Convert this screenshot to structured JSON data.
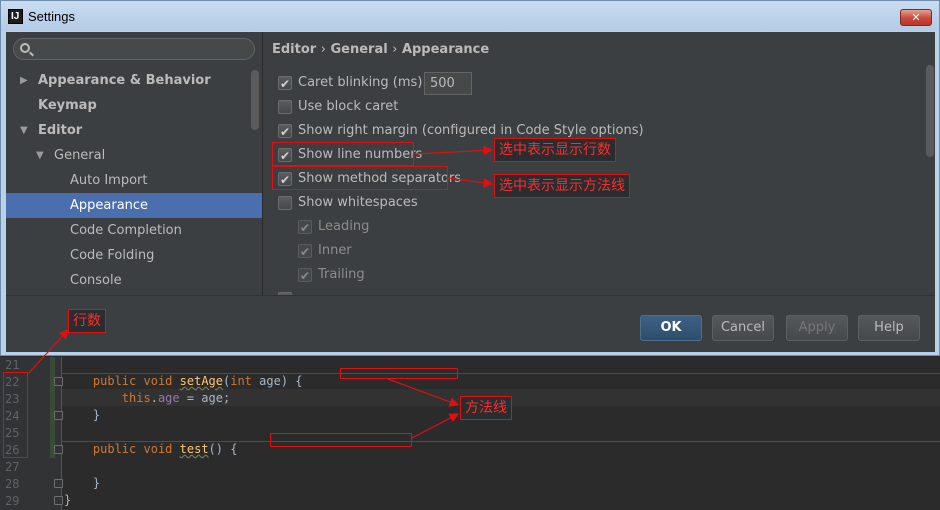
{
  "window": {
    "title": "Settings",
    "logo_letters": "IJ",
    "close_glyph": "✕"
  },
  "sidebar": {
    "search_placeholder": "",
    "items": [
      {
        "label": "Appearance & Behavior",
        "level": 0,
        "bold": true,
        "arrow": "▶",
        "selected": false
      },
      {
        "label": "Keymap",
        "level": 0,
        "bold": true,
        "arrow": "",
        "selected": false
      },
      {
        "label": "Editor",
        "level": 0,
        "bold": true,
        "arrow": "▼",
        "selected": false
      },
      {
        "label": "General",
        "level": 1,
        "bold": false,
        "arrow": "▼",
        "selected": false
      },
      {
        "label": "Auto Import",
        "level": 2,
        "bold": false,
        "arrow": "",
        "selected": false
      },
      {
        "label": "Appearance",
        "level": 2,
        "bold": false,
        "arrow": "",
        "selected": true
      },
      {
        "label": "Code Completion",
        "level": 2,
        "bold": false,
        "arrow": "",
        "selected": false
      },
      {
        "label": "Code Folding",
        "level": 2,
        "bold": false,
        "arrow": "",
        "selected": false
      },
      {
        "label": "Console",
        "level": 2,
        "bold": false,
        "arrow": "",
        "selected": false
      }
    ]
  },
  "breadcrumb": {
    "editor": "Editor",
    "general": "General",
    "appearance": "Appearance",
    "separator": "›"
  },
  "options": {
    "caret_blinking": {
      "label": "Caret blinking (ms):",
      "checked": true,
      "value": "500"
    },
    "block_caret": {
      "label": "Use block caret",
      "checked": false
    },
    "right_margin": {
      "label": "Show right margin (configured in Code Style options)",
      "checked": true
    },
    "line_numbers": {
      "label": "Show line numbers",
      "checked": true
    },
    "method_separators": {
      "label": "Show method separators",
      "checked": true
    },
    "whitespaces": {
      "label": "Show whitespaces",
      "checked": false
    },
    "leading": {
      "label": "Leading",
      "checked": true
    },
    "inner": {
      "label": "Inner",
      "checked": true
    },
    "trailing": {
      "label": "Trailing",
      "checked": true
    }
  },
  "buttons": {
    "ok": "OK",
    "cancel": "Cancel",
    "apply": "Apply",
    "help": "Help"
  },
  "editor": {
    "line_numbers": [
      "21",
      "22",
      "23",
      "24",
      "25",
      "26",
      "27",
      "28",
      "29"
    ],
    "lines": {
      "l22": {
        "kw1": "public",
        "kw2": "void",
        "fn": "setAge",
        "p1": "(",
        "kw3": "int",
        "rest": " age) {"
      },
      "l23": {
        "kw": "this",
        "dot": ".",
        "field": "age",
        "rest": " = age;"
      },
      "l24": "}",
      "l26": {
        "kw1": "public",
        "kw2": "void",
        "fn": "test",
        "rest": "() {"
      },
      "l28": "}",
      "l29": "}"
    }
  },
  "annotations": {
    "line_numbers_note": "选中表示显示行数",
    "method_separators_note": "选中表示显示方法线",
    "rows_note": "行数",
    "method_line_note": "方法线",
    "color": "#e01010"
  }
}
